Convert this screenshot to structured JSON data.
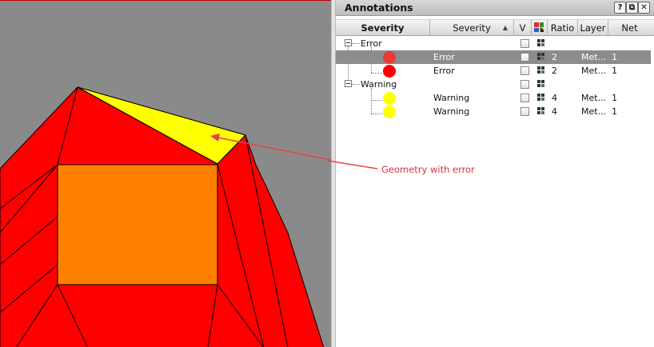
{
  "canvas": {
    "annotation": "Geometry with error",
    "colors": {
      "background": "#8a8a8a",
      "shape_fill": "#ff0000",
      "inner_block": "#ff8000",
      "error_region": "#ffff00",
      "arrow": "#e8424b"
    }
  },
  "panel": {
    "title": "Annotations",
    "header_buttons": [
      {
        "label": "?",
        "icon": "help-icon"
      },
      {
        "label": "⧉",
        "icon": "restore-icon"
      },
      {
        "label": "✕",
        "icon": "close-icon"
      }
    ],
    "columns": {
      "severity_tree": "Severity",
      "severity": "Severity",
      "visible": "V",
      "select_icon": "select-grid-icon",
      "ratio": "Ratio",
      "layer": "Layer",
      "net": "Net"
    },
    "groups": [
      {
        "label": "Error",
        "items": [
          {
            "color": "#e53b3b",
            "severity": "Error",
            "ratio": "2",
            "layer": "Met...",
            "net": "1",
            "selected": true
          },
          {
            "color": "#ff0000",
            "severity": "Error",
            "ratio": "2",
            "layer": "Met...",
            "net": "1",
            "selected": false
          }
        ]
      },
      {
        "label": "Warning",
        "items": [
          {
            "color": "#ffff00",
            "severity": "Warning",
            "ratio": "4",
            "layer": "Met...",
            "net": "1",
            "selected": false
          },
          {
            "color": "#ffff00",
            "severity": "Warning",
            "ratio": "4",
            "layer": "Met...",
            "net": "1",
            "selected": false
          }
        ]
      }
    ]
  }
}
